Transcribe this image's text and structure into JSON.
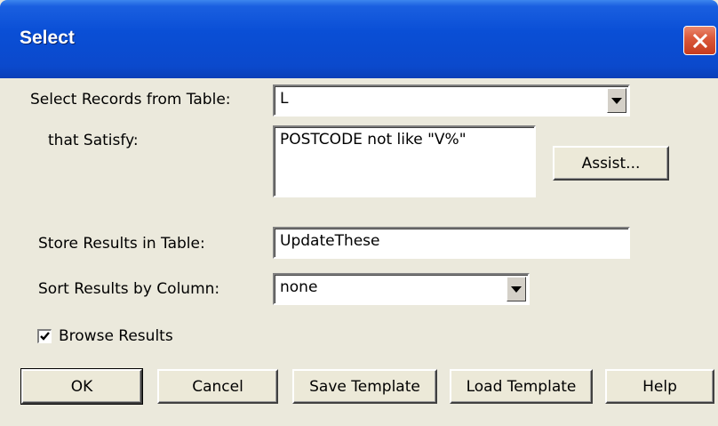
{
  "window": {
    "title": "Select",
    "close_icon": "close-icon"
  },
  "form": {
    "select_records_label": "Select Records from Table:",
    "table_value": "L",
    "that_satisfy_label": "that Satisfy:",
    "condition_value": "POSTCODE not like \"V%\"",
    "assist_button": "Assist...",
    "store_results_label": "Store Results in Table:",
    "store_results_value": "UpdateThese",
    "sort_results_label": "Sort Results by Column:",
    "sort_value": "none",
    "browse_results_label": "Browse Results",
    "browse_results_checked": true
  },
  "buttons": {
    "ok": "OK",
    "cancel": "Cancel",
    "save_template": "Save Template",
    "load_template": "Load Template",
    "help": "Help"
  },
  "colors": {
    "titlebar": "#0a4fd6",
    "close": "#c63b1e",
    "dialog": "#ebe9dc"
  }
}
